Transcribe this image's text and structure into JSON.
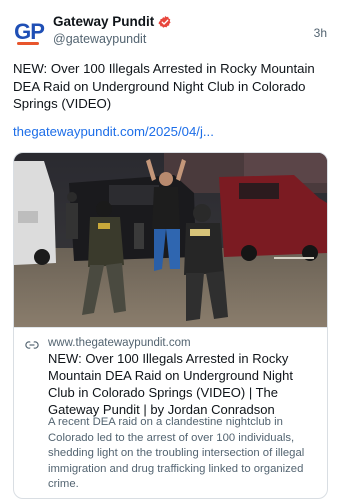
{
  "post": {
    "author_name": "Gateway Pundit",
    "author_handle": "@gatewaypundit",
    "time_ago": "3h",
    "avatar_text_g": "G",
    "avatar_text_p": "P",
    "text": "NEW: Over 100 Illegals Arrested in Rocky Mountain DEA Raid on Underground Night Club in Colorado Springs (VIDEO)",
    "link_text": "thegatewaypundit.com/2025/04/j..."
  },
  "link_card": {
    "domain": "www.thegatewaypundit.com",
    "title": "NEW: Over 100 Illegals Arrested in Rocky Mountain DEA Raid on Underground Night Club in Colorado Springs (VIDEO) | The Gateway Pundit | by Jordan Conradson",
    "description": "A recent DEA raid on a clandestine nightclub in Colorado led to the arrest of over 100 individuals, shedding light on the troubling intersection of illegal immigration and drug trafficking linked to organized crime."
  },
  "icons": {
    "verified": "verified-badge-icon",
    "link": "link-icon"
  },
  "colors": {
    "brand_blue": "#1f4fb5",
    "brand_orange": "#e8552c",
    "verified_red": "#e8463c",
    "link_blue": "#1d6ee8",
    "muted": "#536471"
  }
}
